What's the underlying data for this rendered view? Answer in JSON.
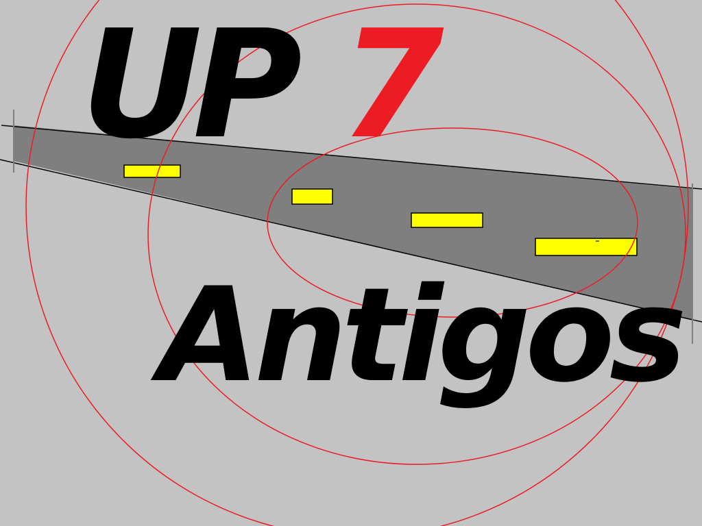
{
  "logo": {
    "title_prefix": "UP",
    "title_number": "7",
    "subtitle": "Antigos"
  },
  "colors": {
    "background": "#c3c3c3",
    "road": "#7f7f7f",
    "lane_marking": "#ffff00",
    "ring": "#ed1c24",
    "text": "#000000",
    "accent": "#ed1c24"
  }
}
